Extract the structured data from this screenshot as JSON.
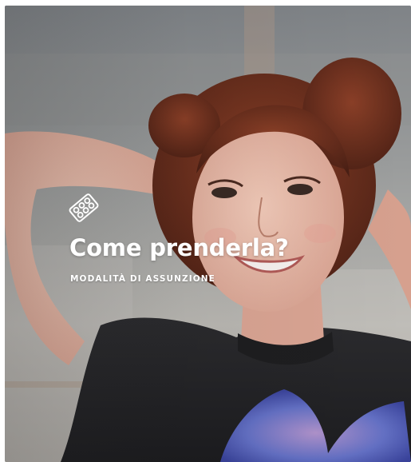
{
  "hero": {
    "icon": "pill-blister-icon",
    "title": "Come prenderla?",
    "subtitle": "MODALITÀ DI ASSUNZIONE",
    "text_color": "#ffffff"
  }
}
